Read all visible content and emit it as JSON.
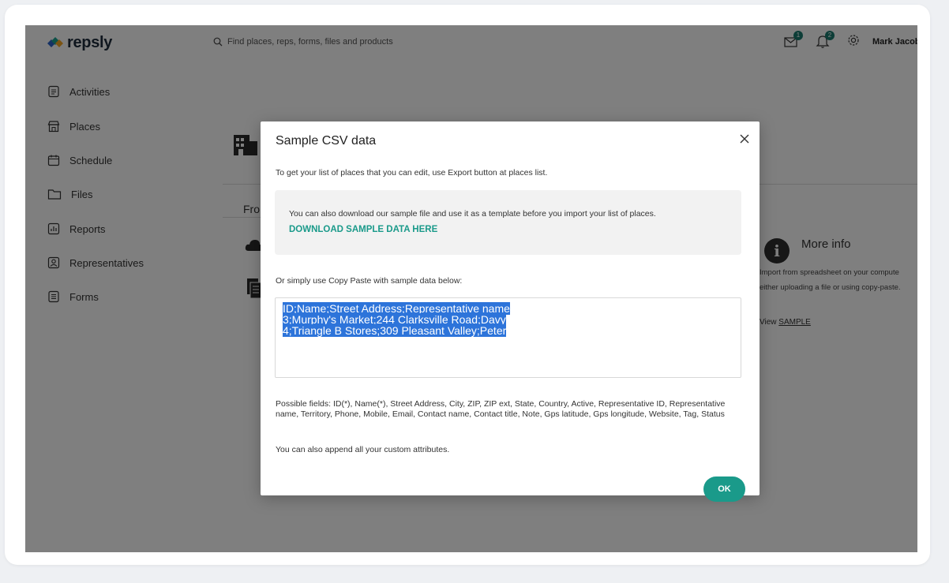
{
  "app": {
    "logo_text": "repsly",
    "search_placeholder": "Find places, reps, forms, files and products",
    "messages_badge": "1",
    "notifications_badge": "2",
    "user_name": "Mark Jacobs"
  },
  "sidebar": {
    "items": [
      {
        "label": "Activities",
        "icon": "activities-icon"
      },
      {
        "label": "Places",
        "icon": "places-icon"
      },
      {
        "label": "Schedule",
        "icon": "schedule-icon"
      },
      {
        "label": "Files",
        "icon": "files-icon"
      },
      {
        "label": "Reports",
        "icon": "reports-icon"
      },
      {
        "label": "Representatives",
        "icon": "representatives-icon"
      },
      {
        "label": "Forms",
        "icon": "forms-icon"
      }
    ]
  },
  "background": {
    "tab_label": "Fro",
    "more_info_title": "More info",
    "more_info_line1": "Import from spreadsheet on your compute",
    "more_info_line2": "either uploading a file or using copy-paste.",
    "view_prefix": "View ",
    "view_link": "SAMPLE"
  },
  "modal": {
    "title": "Sample CSV data",
    "intro": "To get your list of places that you can edit, use Export button at places list.",
    "info_text": "You can also download our sample file and use it as a template before you import your list of places.",
    "download_link": "DOWNLOAD SAMPLE DATA HERE",
    "copy_label": "Or simply use Copy Paste with sample data below:",
    "csv_lines": [
      "ID;Name;Street Address;Representative name",
      "3;Murphy's Market;244 Clarksville Road;Davy",
      "4;Triangle B Stores;309 Pleasant Valley;Peter"
    ],
    "fields_text": "Possible fields: ID(*), Name(*), Street Address, City, ZIP, ZIP ext, State, Country, Active, Representative ID, Representative name, Territory, Phone, Mobile, Email, Contact name, Contact title, Note, Gps latitude, Gps longitude, Website, Tag, Status",
    "append_text": "You can also append all your custom attributes.",
    "ok_label": "OK"
  },
  "colors": {
    "accent": "#1a9a8a",
    "overlay": "rgba(0,0,0,0.5)",
    "selection": "#2d74da"
  }
}
